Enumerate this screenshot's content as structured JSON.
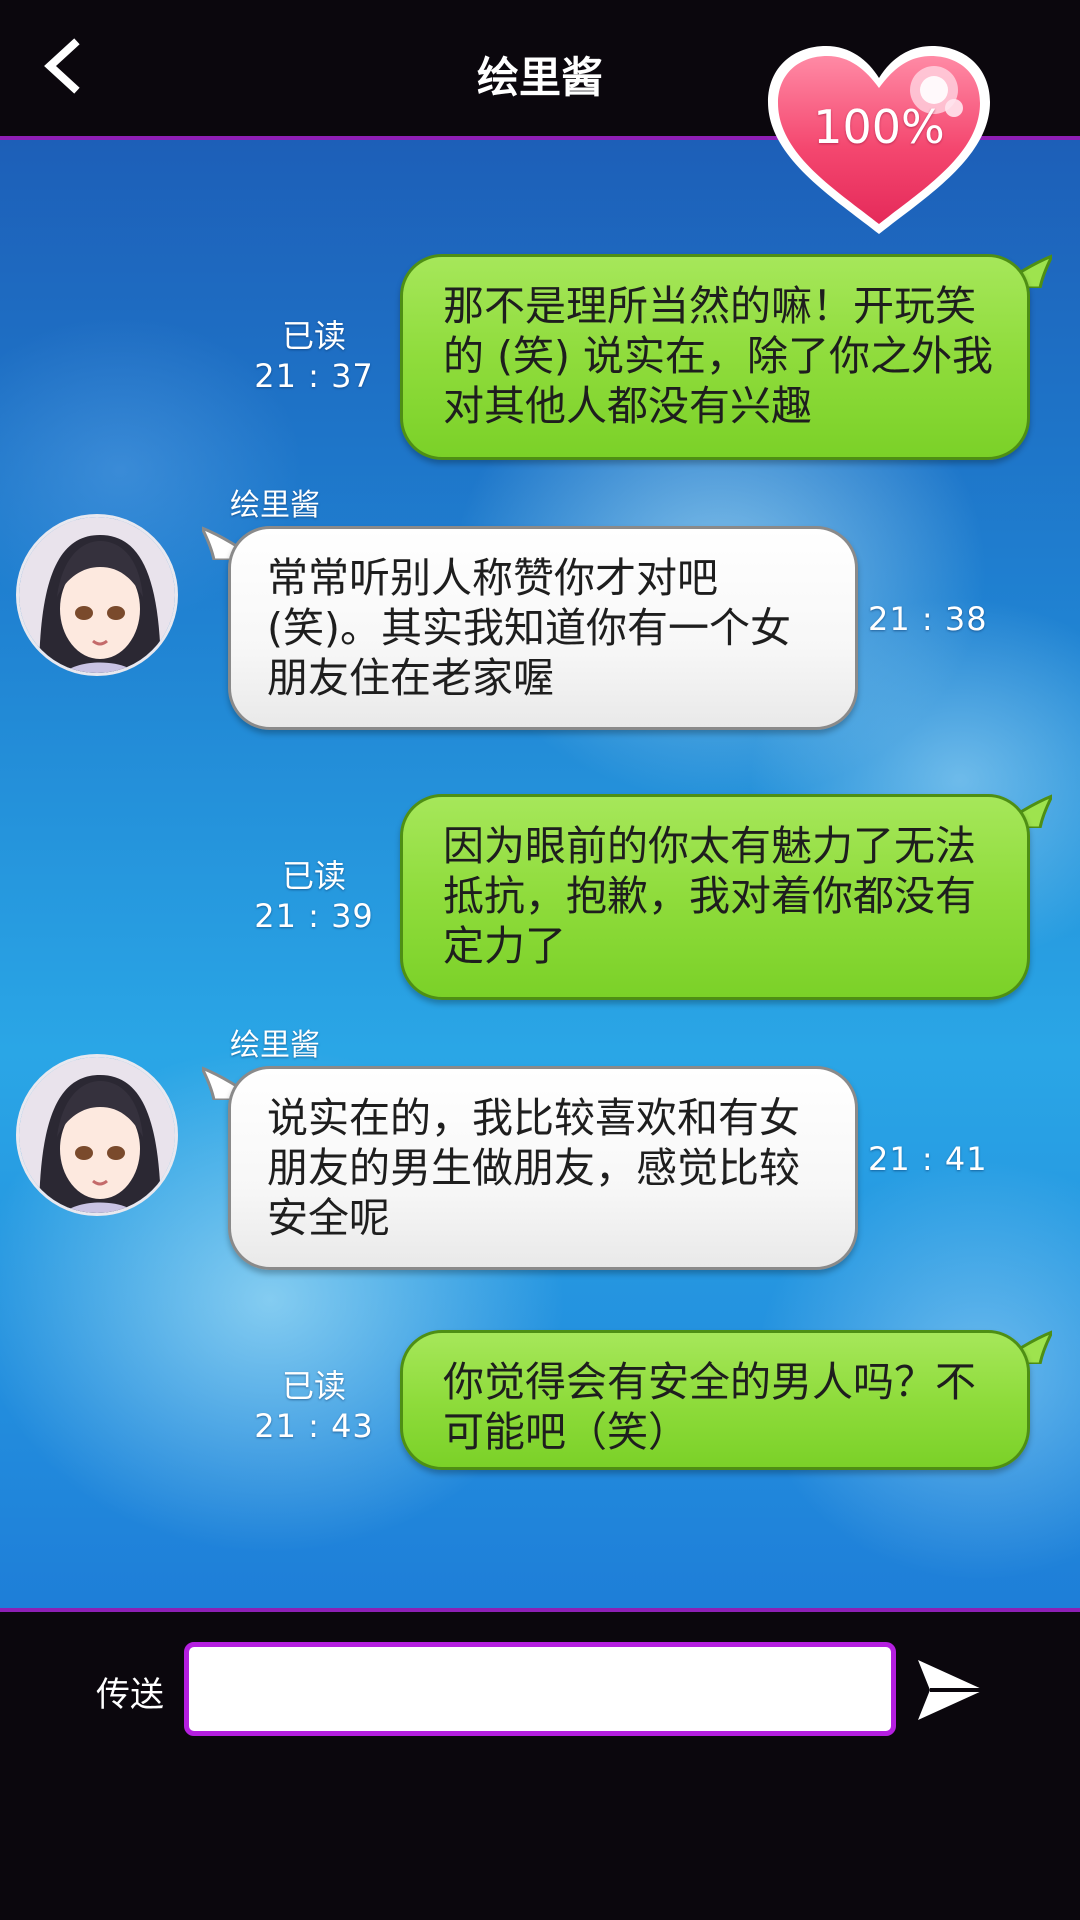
{
  "header": {
    "title": "绘里酱",
    "back_icon": "chevron-left-icon"
  },
  "affection": {
    "label": "100%",
    "level_percent": 100,
    "color": "#f0406e"
  },
  "messages": [
    {
      "from": "me",
      "text": "那不是理所当然的嘛！开玩笑的 (笑) 说实在，除了你之外我对其他人都没有兴趣",
      "read": "已读",
      "time": "21 : 37"
    },
    {
      "from": "her",
      "sender": "绘里酱",
      "text": "常常听别人称赞你才对吧 (笑)。其实我知道你有一个女朋友住在老家喔",
      "time": "21 : 38"
    },
    {
      "from": "me",
      "text": "因为眼前的你太有魅力了无法抵抗，抱歉，我对着你都没有定力了",
      "read": "已读",
      "time": "21 : 39"
    },
    {
      "from": "her",
      "sender": "绘里酱",
      "text": "说实在的，我比较喜欢和有女朋友的男生做朋友，感觉比较安全呢",
      "time": "21 : 41"
    },
    {
      "from": "me",
      "text": "你觉得会有安全的男人吗？不可能吧（笑）",
      "read": "已读",
      "time": "21 : 43"
    }
  ],
  "composer": {
    "send_label": "传送",
    "input_value": "",
    "send_icon": "paper-plane-icon"
  },
  "colors": {
    "my_bubble": "#8fdc3c",
    "her_bubble": "#ffffff",
    "accent_border": "#8e1fb5",
    "input_border": "#b51fe0"
  }
}
